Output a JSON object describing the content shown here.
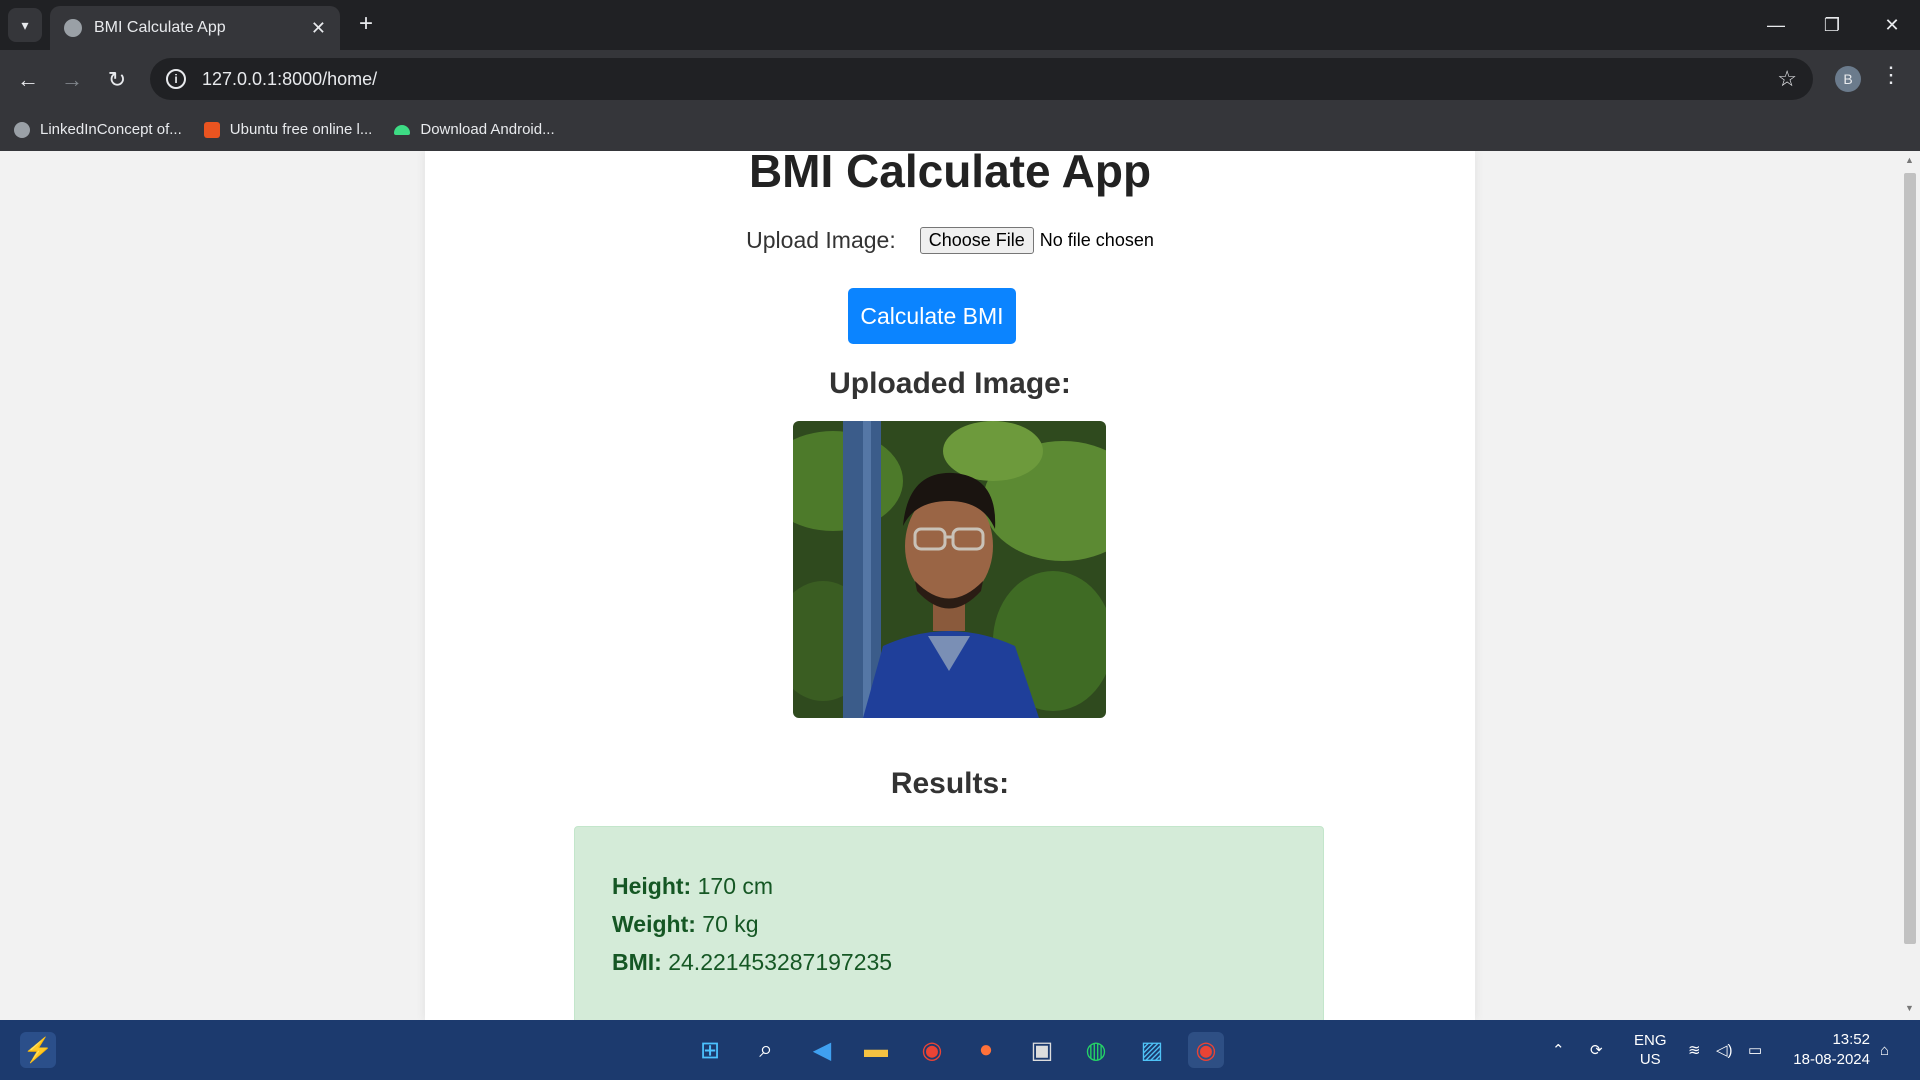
{
  "browser": {
    "tab_title": "BMI Calculate App",
    "url": "127.0.0.1:8000/home/",
    "profile_initial": "B",
    "bookmarks": [
      {
        "label": "LinkedInConcept of...",
        "icon": "globe-icon"
      },
      {
        "label": "Ubuntu free online l...",
        "icon": "ubuntu-icon"
      },
      {
        "label": "Download Android...",
        "icon": "android-icon"
      }
    ]
  },
  "page": {
    "title": "BMI Calculate App",
    "upload_label": "Upload Image:",
    "choose_file_label": "Choose File",
    "no_file_text": "No file chosen",
    "calculate_button": "Calculate BMI",
    "uploaded_heading": "Uploaded Image:",
    "results_heading": "Results:",
    "results": {
      "height_label": "Height:",
      "height_value": " 170 cm",
      "weight_label": "Weight:",
      "weight_value": " 70 kg",
      "bmi_label": "BMI:",
      "bmi_value": " 24.221453287197235"
    }
  },
  "taskbar": {
    "language": "ENG",
    "region": "US",
    "time": "13:52",
    "date": "18-08-2024"
  },
  "colors": {
    "accent_button": "#0b84ff",
    "results_bg": "#d4ebd8",
    "results_text": "#155724",
    "taskbar_bg": "#1c3a6e"
  }
}
